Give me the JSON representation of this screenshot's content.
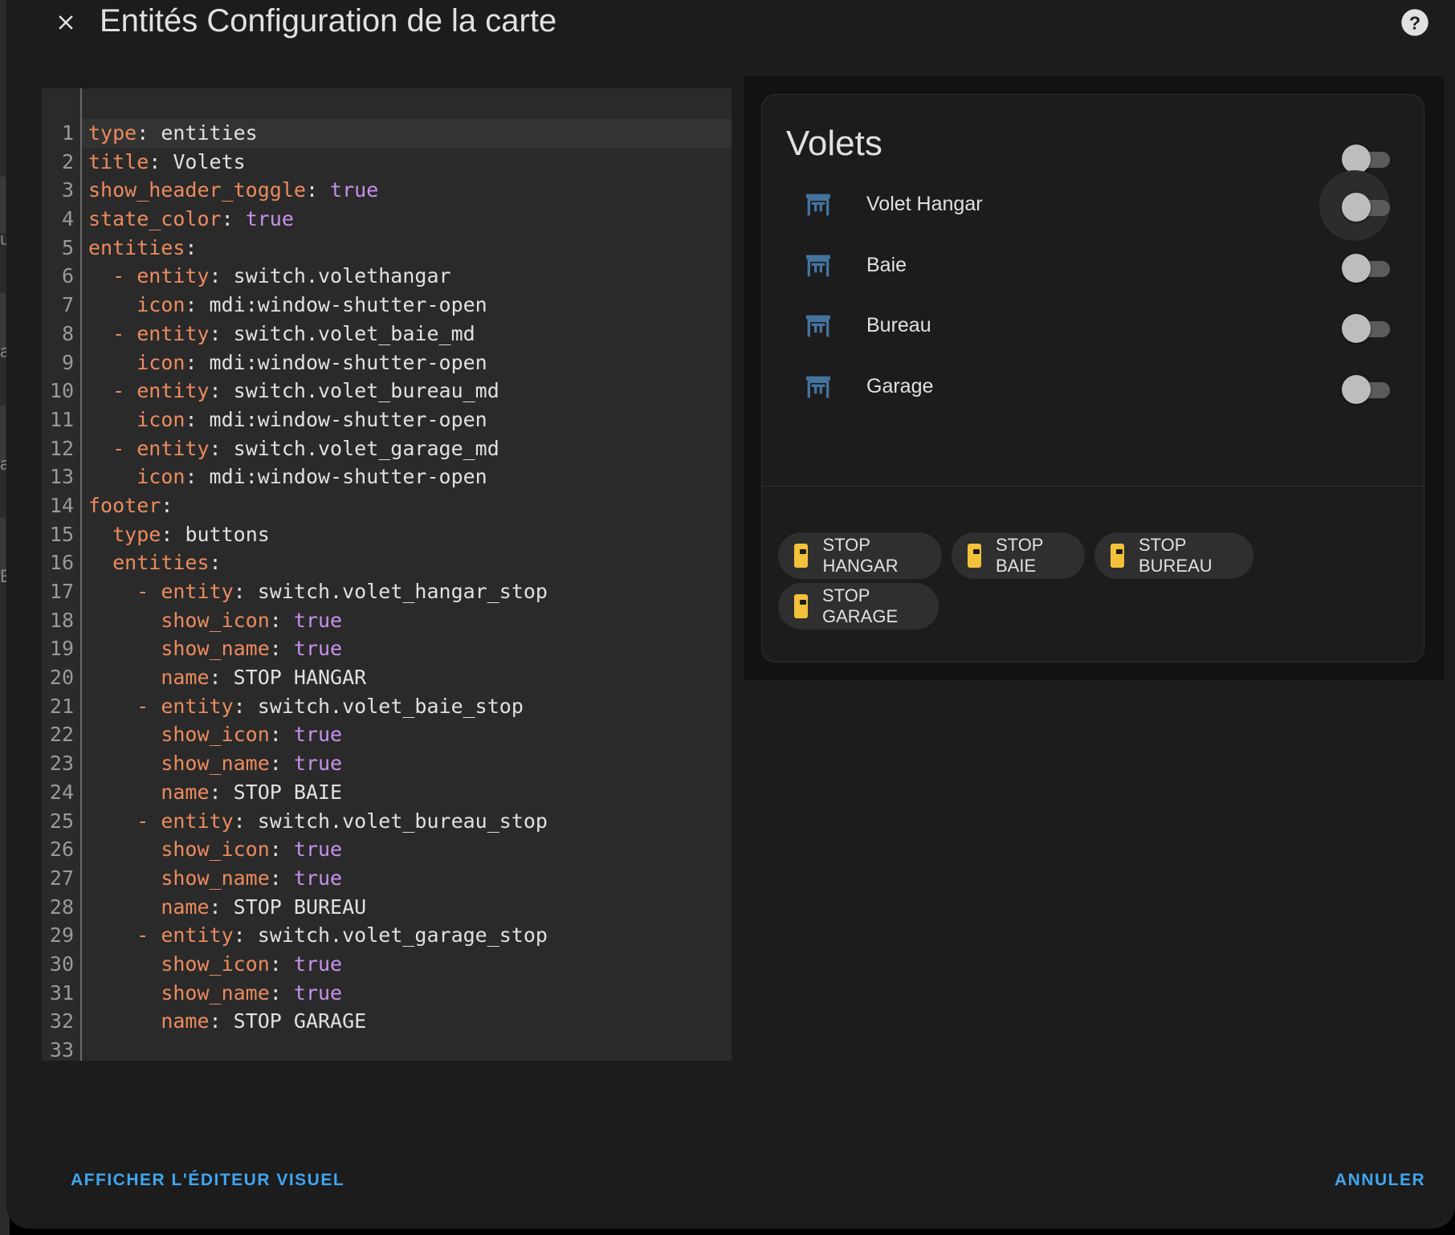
{
  "dialog": {
    "title": "Entités Configuration de la carte",
    "close_icon": "close-icon",
    "help_icon": "help-circle-icon"
  },
  "editor": {
    "lines": [
      {
        "n": "1",
        "indent": "",
        "dash": "",
        "key": "type",
        "sep": ": ",
        "val": "entities",
        "bool": ""
      },
      {
        "n": "2",
        "indent": "",
        "dash": "",
        "key": "title",
        "sep": ": ",
        "val": "Volets",
        "bool": ""
      },
      {
        "n": "3",
        "indent": "",
        "dash": "",
        "key": "show_header_toggle",
        "sep": ": ",
        "val": "",
        "bool": "true"
      },
      {
        "n": "4",
        "indent": "",
        "dash": "",
        "key": "state_color",
        "sep": ": ",
        "val": "",
        "bool": "true"
      },
      {
        "n": "5",
        "indent": "",
        "dash": "",
        "key": "entities",
        "sep": ":",
        "val": "",
        "bool": ""
      },
      {
        "n": "6",
        "indent": "  ",
        "dash": "- ",
        "key": "entity",
        "sep": ": ",
        "val": "switch.volethangar",
        "bool": ""
      },
      {
        "n": "7",
        "indent": "    ",
        "dash": "",
        "key": "icon",
        "sep": ": ",
        "val": "mdi:window-shutter-open",
        "bool": ""
      },
      {
        "n": "8",
        "indent": "  ",
        "dash": "- ",
        "key": "entity",
        "sep": ": ",
        "val": "switch.volet_baie_md",
        "bool": ""
      },
      {
        "n": "9",
        "indent": "    ",
        "dash": "",
        "key": "icon",
        "sep": ": ",
        "val": "mdi:window-shutter-open",
        "bool": ""
      },
      {
        "n": "10",
        "indent": "  ",
        "dash": "- ",
        "key": "entity",
        "sep": ": ",
        "val": "switch.volet_bureau_md",
        "bool": ""
      },
      {
        "n": "11",
        "indent": "    ",
        "dash": "",
        "key": "icon",
        "sep": ": ",
        "val": "mdi:window-shutter-open",
        "bool": ""
      },
      {
        "n": "12",
        "indent": "  ",
        "dash": "- ",
        "key": "entity",
        "sep": ": ",
        "val": "switch.volet_garage_md",
        "bool": ""
      },
      {
        "n": "13",
        "indent": "    ",
        "dash": "",
        "key": "icon",
        "sep": ": ",
        "val": "mdi:window-shutter-open",
        "bool": ""
      },
      {
        "n": "14",
        "indent": "",
        "dash": "",
        "key": "footer",
        "sep": ":",
        "val": "",
        "bool": ""
      },
      {
        "n": "15",
        "indent": "  ",
        "dash": "",
        "key": "type",
        "sep": ": ",
        "val": "buttons",
        "bool": ""
      },
      {
        "n": "16",
        "indent": "  ",
        "dash": "",
        "key": "entities",
        "sep": ":",
        "val": "",
        "bool": ""
      },
      {
        "n": "17",
        "indent": "    ",
        "dash": "- ",
        "key": "entity",
        "sep": ": ",
        "val": "switch.volet_hangar_stop",
        "bool": ""
      },
      {
        "n": "18",
        "indent": "      ",
        "dash": "",
        "key": "show_icon",
        "sep": ": ",
        "val": "",
        "bool": "true"
      },
      {
        "n": "19",
        "indent": "      ",
        "dash": "",
        "key": "show_name",
        "sep": ": ",
        "val": "",
        "bool": "true"
      },
      {
        "n": "20",
        "indent": "      ",
        "dash": "",
        "key": "name",
        "sep": ": ",
        "val": "STOP HANGAR",
        "bool": ""
      },
      {
        "n": "21",
        "indent": "    ",
        "dash": "- ",
        "key": "entity",
        "sep": ": ",
        "val": "switch.volet_baie_stop",
        "bool": ""
      },
      {
        "n": "22",
        "indent": "      ",
        "dash": "",
        "key": "show_icon",
        "sep": ": ",
        "val": "",
        "bool": "true"
      },
      {
        "n": "23",
        "indent": "      ",
        "dash": "",
        "key": "show_name",
        "sep": ": ",
        "val": "",
        "bool": "true"
      },
      {
        "n": "24",
        "indent": "      ",
        "dash": "",
        "key": "name",
        "sep": ": ",
        "val": "STOP BAIE",
        "bool": ""
      },
      {
        "n": "25",
        "indent": "    ",
        "dash": "- ",
        "key": "entity",
        "sep": ": ",
        "val": "switch.volet_bureau_stop",
        "bool": ""
      },
      {
        "n": "26",
        "indent": "      ",
        "dash": "",
        "key": "show_icon",
        "sep": ": ",
        "val": "",
        "bool": "true"
      },
      {
        "n": "27",
        "indent": "      ",
        "dash": "",
        "key": "show_name",
        "sep": ": ",
        "val": "",
        "bool": "true"
      },
      {
        "n": "28",
        "indent": "      ",
        "dash": "",
        "key": "name",
        "sep": ": ",
        "val": "STOP BUREAU",
        "bool": ""
      },
      {
        "n": "29",
        "indent": "    ",
        "dash": "- ",
        "key": "entity",
        "sep": ": ",
        "val": "switch.volet_garage_stop",
        "bool": ""
      },
      {
        "n": "30",
        "indent": "      ",
        "dash": "",
        "key": "show_icon",
        "sep": ": ",
        "val": "",
        "bool": "true"
      },
      {
        "n": "31",
        "indent": "      ",
        "dash": "",
        "key": "show_name",
        "sep": ": ",
        "val": "",
        "bool": "true"
      },
      {
        "n": "32",
        "indent": "      ",
        "dash": "",
        "key": "name",
        "sep": ": ",
        "val": "STOP GARAGE",
        "bool": ""
      },
      {
        "n": "33",
        "indent": "",
        "dash": "",
        "key": "",
        "sep": "",
        "val": "",
        "bool": ""
      }
    ]
  },
  "preview": {
    "card_title": "Volets",
    "header_toggle_on": false,
    "entities": [
      {
        "label": "Volet Hangar",
        "icon": "window-shutter-open-icon",
        "on": false
      },
      {
        "label": "Baie",
        "icon": "window-shutter-open-icon",
        "on": false
      },
      {
        "label": "Bureau",
        "icon": "window-shutter-open-icon",
        "on": false
      },
      {
        "label": "Garage",
        "icon": "window-shutter-open-icon",
        "on": false
      }
    ],
    "buttons": [
      {
        "label": "STOP HANGAR",
        "icon": "power-socket-icon"
      },
      {
        "label": "STOP BAIE",
        "icon": "power-socket-icon"
      },
      {
        "label": "STOP BUREAU",
        "icon": "power-socket-icon"
      },
      {
        "label": "STOP GARAGE",
        "icon": "power-socket-icon"
      }
    ],
    "icon_color": "#44739e",
    "button_icon_color": "#f3c13a"
  },
  "footer": {
    "visual_editor_label": "AFFICHER L'ÉDITEUR VISUEL",
    "cancel_label": "ANNULER"
  },
  "colors": {
    "accent": "#3ea6f0",
    "yaml_key": "#ec8b5e",
    "yaml_bool": "#c792ea"
  },
  "background_fragments": [
    "a",
    "a",
    "E",
    "u"
  ]
}
